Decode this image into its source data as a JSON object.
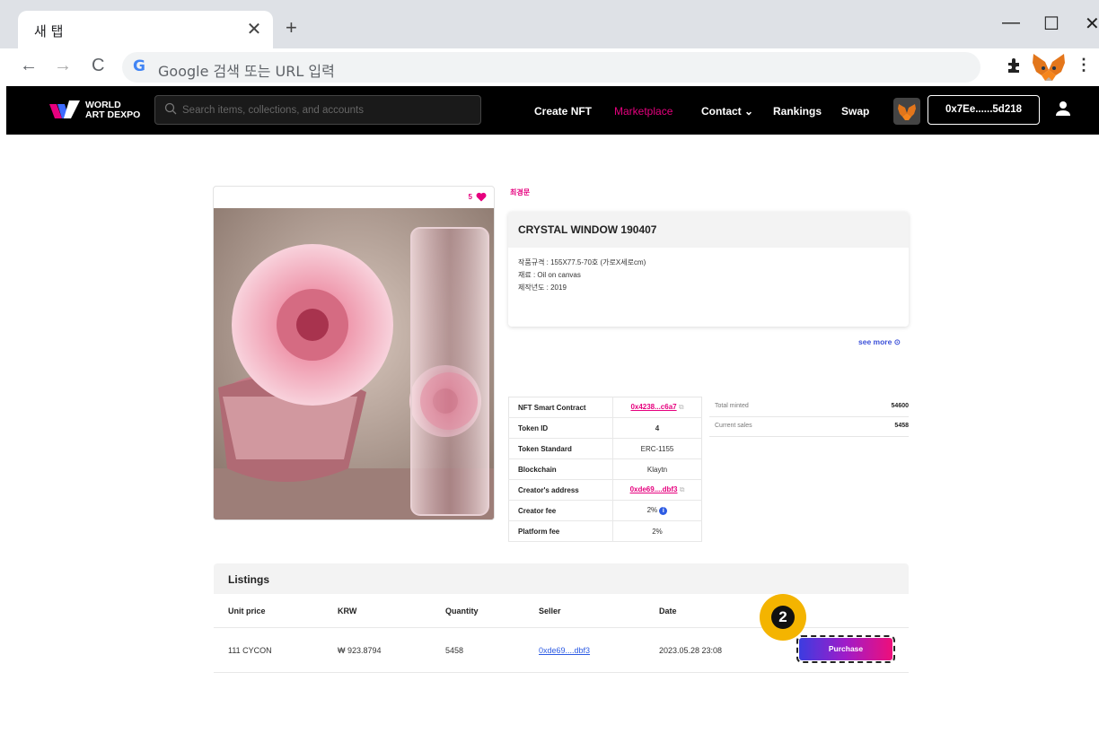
{
  "browser": {
    "tab_title": "새 탭",
    "tab_close": "✕",
    "new_tab": "+",
    "omnibox_g": "G",
    "omnibox_placeholder": "Google 검색 또는 URL 입력",
    "minimize": "—",
    "maximize": "☐",
    "close": "✕",
    "back": "←",
    "forward": "→",
    "reload": "C",
    "menu": "⋮"
  },
  "site": {
    "logo_line1": "WORLD",
    "logo_line2": "ART DEXPO",
    "search_placeholder": "Search items, collections, and accounts",
    "nav": {
      "create": "Create NFT",
      "marketplace": "Marketplace",
      "contact": "Contact ⌄",
      "rankings": "Rankings",
      "swap": "Swap"
    },
    "wallet_address": "0x7Ee......5d218",
    "accent_color": "#e6007e"
  },
  "artwork": {
    "likes": "5",
    "creator": "최경문",
    "title": "CRYSTAL WINDOW 190407",
    "details": [
      "작품규격 : 155X77.5-70호 (가로X세로cm)",
      "재료 : Oil on canvas",
      "제작년도 : 2019"
    ],
    "see_more": "see more ⊙"
  },
  "contract": {
    "rows": [
      {
        "label": "NFT Smart Contract",
        "value": "0x4238...c6a7"
      },
      {
        "label": "Token ID",
        "value": "4"
      },
      {
        "label": "Token Standard",
        "value": "ERC-1155"
      },
      {
        "label": "Blockchain",
        "value": "Klaytn"
      },
      {
        "label": "Creator's address",
        "value": "0xde69....dbf3"
      },
      {
        "label": "Creator fee",
        "value": "2%"
      },
      {
        "label": "Platform fee",
        "value": "2%"
      }
    ]
  },
  "stats": {
    "total_minted_label": "Total minted",
    "total_minted": "54600",
    "current_sales_label": "Current sales",
    "current_sales": "5458"
  },
  "listings": {
    "heading": "Listings",
    "columns": [
      "Unit price",
      "KRW",
      "Quantity",
      "Seller",
      "Date"
    ],
    "row": {
      "unit_price": "111 CYCON",
      "krw": "₩ 923.8794",
      "quantity": "5458",
      "seller": "0xde69....dbf3",
      "date": "2023.05.28 23:08"
    },
    "purchase_label": "Purchase",
    "step_number": "2"
  }
}
